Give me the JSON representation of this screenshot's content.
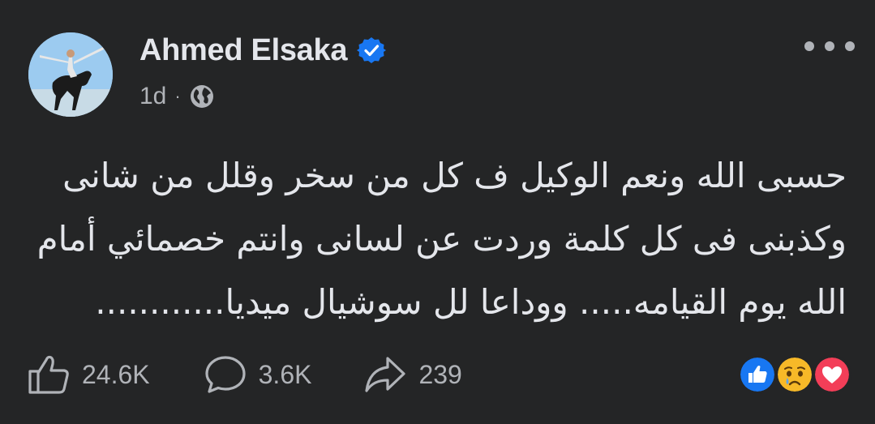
{
  "author": {
    "name": "Ahmed Elsaka",
    "verified_icon": "verified-badge-icon",
    "avatar_icon": "profile-avatar"
  },
  "meta": {
    "time": "1d",
    "separator": "·",
    "audience_icon": "globe-icon"
  },
  "menu": {
    "icon": "more-options-icon"
  },
  "post": {
    "text": "حسبى الله ونعم الوكيل ف كل من سخر وقلل من شانى وكذبنى فى كل كلمة وردت عن لسانى وانتم خصمائي أمام الله يوم القيامه..... ووداعا لل سوشيال ميديا............"
  },
  "actions": {
    "like": {
      "icon": "thumbs-up-icon",
      "count": "24.6K"
    },
    "comment": {
      "icon": "comment-bubble-icon",
      "count": "3.6K"
    },
    "share": {
      "icon": "share-arrow-icon",
      "count": "239"
    }
  },
  "reactions": [
    "like-reaction-icon",
    "sad-reaction-icon",
    "love-reaction-icon"
  ],
  "colors": {
    "background": "#242526",
    "primary_text": "#e4e6eb",
    "secondary_text": "#b0b3b8",
    "accent_blue": "#1877f2",
    "love_red": "#f33e58",
    "sad_yellow": "#f7b928"
  }
}
